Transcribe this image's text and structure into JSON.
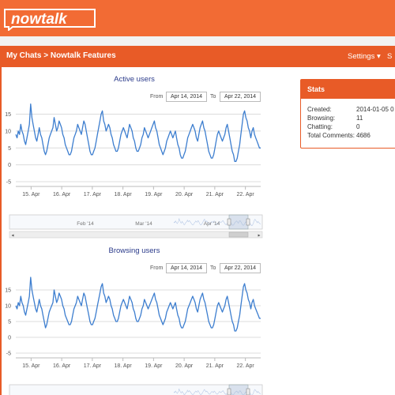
{
  "header": {
    "logo_text": "nowtalk",
    "breadcrumb": "My Chats > Nowtalk Features",
    "settings_label": "Settings",
    "settings_caret": "▾",
    "next_menu_partial": "S"
  },
  "stats": {
    "title": "Stats",
    "rows": [
      {
        "label": "Created:",
        "value": "2014-01-05 0"
      },
      {
        "label": "Browsing:",
        "value": "11"
      },
      {
        "label": "Chatting:",
        "value": "0"
      },
      {
        "label": "Total Comments:",
        "value": "4686"
      }
    ]
  },
  "chart_data": [
    {
      "type": "line",
      "title": "Active users",
      "range": {
        "from_label": "From",
        "from": "Apr 14, 2014",
        "to_label": "To",
        "to": "Apr 22, 2014"
      },
      "x": [
        "15. Apr",
        "16. Apr",
        "17. Apr",
        "18. Apr",
        "19. Apr",
        "20. Apr",
        "21. Apr",
        "22. Apr"
      ],
      "yticks": [
        -5,
        0,
        5,
        10,
        15
      ],
      "ylim": [
        -5,
        17
      ],
      "values": [
        9,
        8,
        10,
        9,
        12,
        10,
        9,
        7,
        6,
        8,
        10,
        12,
        18,
        14,
        12,
        10,
        8,
        7,
        9,
        11,
        9,
        8,
        6,
        4,
        3,
        4,
        6,
        8,
        9,
        10,
        11,
        14,
        12,
        10,
        11,
        13,
        12,
        11,
        9,
        8,
        6,
        5,
        4,
        3,
        3,
        4,
        6,
        8,
        9,
        10,
        12,
        11,
        10,
        9,
        11,
        13,
        12,
        10,
        8,
        6,
        4,
        3,
        3,
        4,
        5,
        7,
        9,
        11,
        13,
        15,
        16,
        13,
        12,
        10,
        11,
        12,
        11,
        9,
        8,
        6,
        5,
        4,
        4,
        5,
        7,
        9,
        10,
        11,
        10,
        9,
        8,
        10,
        12,
        11,
        10,
        8,
        7,
        5,
        4,
        4,
        5,
        6,
        8,
        9,
        11,
        10,
        9,
        8,
        9,
        10,
        11,
        12,
        13,
        11,
        10,
        8,
        6,
        5,
        4,
        3,
        4,
        5,
        7,
        8,
        9,
        10,
        9,
        8,
        9,
        10,
        8,
        6,
        5,
        3,
        2,
        2,
        3,
        4,
        6,
        8,
        9,
        10,
        11,
        12,
        11,
        10,
        8,
        7,
        9,
        11,
        12,
        13,
        11,
        10,
        8,
        6,
        4,
        3,
        2,
        2,
        3,
        5,
        7,
        9,
        10,
        9,
        8,
        7,
        8,
        9,
        11,
        12,
        10,
        8,
        6,
        4,
        3,
        1,
        1,
        2,
        4,
        6,
        9,
        12,
        15,
        16,
        14,
        13,
        11,
        10,
        8,
        10,
        11,
        9,
        8,
        7,
        6,
        5,
        5
      ],
      "navigator": {
        "labels": [
          "Feb '14",
          "Mar '14",
          "Apr '14"
        ]
      }
    },
    {
      "type": "line",
      "title": "Browsing users",
      "range": {
        "from_label": "From",
        "from": "Apr 14, 2014",
        "to_label": "To",
        "to": "Apr 22, 2014"
      },
      "x": [
        "15. Apr",
        "16. Apr",
        "17. Apr",
        "18. Apr",
        "19. Apr",
        "20. Apr",
        "21. Apr",
        "22. Apr"
      ],
      "yticks": [
        -5,
        0,
        5,
        10,
        15
      ],
      "ylim": [
        -5,
        19
      ],
      "values": [
        10,
        9,
        11,
        10,
        13,
        11,
        10,
        8,
        7,
        9,
        11,
        13,
        19,
        15,
        13,
        11,
        9,
        8,
        10,
        12,
        10,
        9,
        7,
        5,
        3,
        4,
        6,
        8,
        9,
        10,
        11,
        15,
        13,
        11,
        12,
        14,
        13,
        12,
        10,
        9,
        7,
        6,
        5,
        4,
        4,
        5,
        7,
        9,
        10,
        11,
        13,
        12,
        11,
        10,
        12,
        14,
        13,
        11,
        9,
        7,
        5,
        4,
        4,
        5,
        6,
        8,
        10,
        12,
        14,
        16,
        17,
        14,
        13,
        11,
        12,
        13,
        12,
        10,
        9,
        7,
        6,
        5,
        5,
        6,
        8,
        10,
        11,
        12,
        11,
        10,
        9,
        11,
        13,
        12,
        11,
        9,
        8,
        6,
        5,
        5,
        6,
        7,
        9,
        10,
        12,
        11,
        10,
        9,
        10,
        11,
        12,
        13,
        14,
        12,
        11,
        9,
        7,
        6,
        5,
        4,
        5,
        6,
        8,
        9,
        10,
        11,
        10,
        9,
        10,
        11,
        9,
        7,
        6,
        4,
        3,
        3,
        4,
        5,
        7,
        9,
        10,
        11,
        12,
        13,
        12,
        11,
        9,
        8,
        10,
        12,
        13,
        14,
        12,
        11,
        9,
        7,
        5,
        4,
        3,
        3,
        4,
        6,
        8,
        10,
        11,
        10,
        9,
        8,
        9,
        10,
        12,
        13,
        11,
        9,
        7,
        5,
        4,
        2,
        2,
        3,
        5,
        7,
        10,
        13,
        16,
        17,
        15,
        14,
        12,
        11,
        9,
        11,
        12,
        10,
        9,
        8,
        7,
        6,
        6
      ]
    }
  ]
}
